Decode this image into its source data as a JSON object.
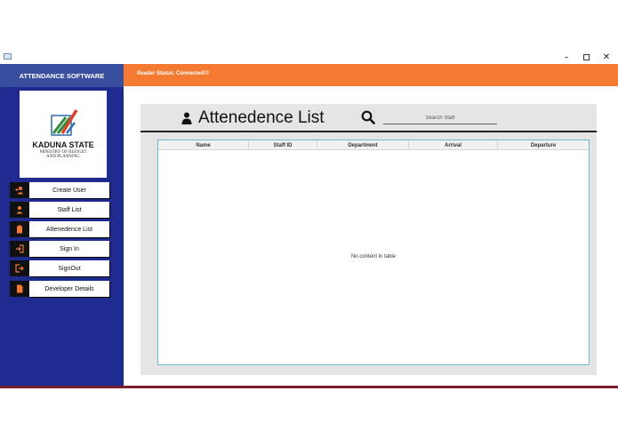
{
  "window": {
    "minimize_glyph": "–",
    "close_glyph": "✕"
  },
  "sidebar": {
    "title": "ATTENDANCE SOFTWARE",
    "logo": {
      "title": "KADUNA STATE",
      "subtitle_line1": "MINISTRY OF BUDGET",
      "subtitle_line2": "AND PLANNING"
    },
    "items": [
      {
        "label": "Create User",
        "icon": "add-user-icon"
      },
      {
        "label": "Staff List",
        "icon": "person-icon"
      },
      {
        "label": "Attenedence List",
        "icon": "clipboard-icon"
      },
      {
        "label": "Sign In",
        "icon": "sign-in-icon"
      },
      {
        "label": "SignOut",
        "icon": "sign-out-icon"
      },
      {
        "label": "Developer Details",
        "icon": "document-icon"
      }
    ]
  },
  "status": {
    "text": "Reader Status: Connected!!!"
  },
  "main": {
    "title": "Attenedence List",
    "search_placeholder": "Search Staff",
    "table": {
      "columns": [
        "Name",
        "Staff ID",
        "Department",
        "Arrival",
        "Departure"
      ],
      "rows": [],
      "empty_message": "No content in table"
    }
  },
  "colors": {
    "sidebar_bg": "#1f2a8f",
    "sidebar_header_bg": "#3a4ea0",
    "status_bar_bg": "#f47a32",
    "nav_icon_accent": "#f47a32",
    "table_border": "#6fb7d6"
  }
}
